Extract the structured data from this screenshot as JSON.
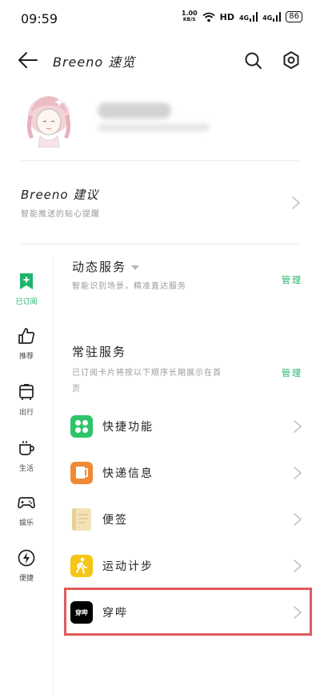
{
  "status_bar": {
    "time": "09:59",
    "speed_value": "1.00",
    "speed_unit": "KB/S",
    "hd_label": "HD",
    "signal_1": "4G",
    "signal_2": "4G",
    "battery": "86"
  },
  "header": {
    "title": "Breeno 速览"
  },
  "suggestion": {
    "title": "Breeno 建议",
    "description": "智能推送的贴心提醒"
  },
  "nav": {
    "items": [
      {
        "label": "已订阅",
        "icon": "bookmark-plus-icon",
        "active": true
      },
      {
        "label": "推荐",
        "icon": "thumbs-up-icon",
        "active": false
      },
      {
        "label": "出行",
        "icon": "bus-icon",
        "active": false
      },
      {
        "label": "生活",
        "icon": "coffee-cup-icon",
        "active": false
      },
      {
        "label": "娱乐",
        "icon": "gamepad-icon",
        "active": false
      },
      {
        "label": "便捷",
        "icon": "lightning-icon",
        "active": false
      }
    ]
  },
  "dynamic_services": {
    "title": "动态服务",
    "description": "智能识别场景，精准直达服务",
    "manage_label": "管理"
  },
  "resident_services": {
    "title": "常驻服务",
    "description_line1": "已订阅卡片将按以下顺序长期展示在首",
    "description_line2": "页",
    "manage_label": "管理"
  },
  "cards": [
    {
      "label": "快捷功能",
      "icon": "quick-functions-icon",
      "color": "#2fc36a"
    },
    {
      "label": "快递信息",
      "icon": "package-icon",
      "color": "#f08a35"
    },
    {
      "label": "便签",
      "icon": "notepad-icon",
      "color": "#f3e2b8"
    },
    {
      "label": "运动计步",
      "icon": "walking-icon",
      "color": "#f5c518"
    },
    {
      "label": "穿哔",
      "icon": "chuanbi-logo-icon",
      "color": "#000000",
      "logo_text": "穿哔"
    }
  ],
  "colors": {
    "accent": "#1fb46a",
    "highlight_border": "#e05a5a"
  }
}
